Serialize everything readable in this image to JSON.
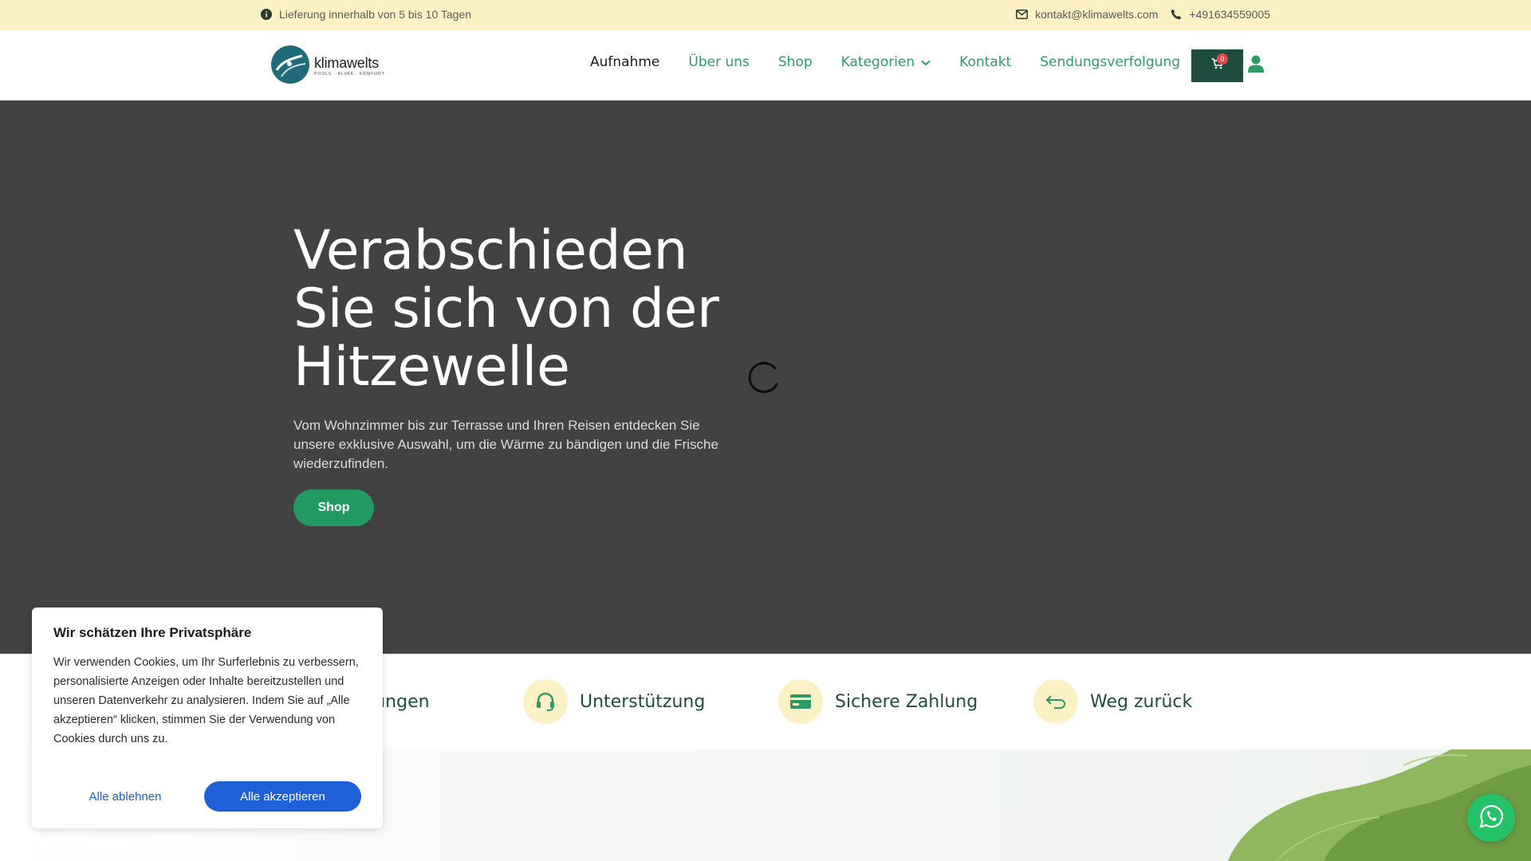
{
  "topbar": {
    "delivery": "Lieferung innerhalb von 5 bis 10 Tagen",
    "email": "kontakt@klimawelts.com",
    "phone": "+491634559005"
  },
  "logo": {
    "name": "klimawelts",
    "tagline": "POOLS · KLIMA · KOMFORT"
  },
  "nav": {
    "items": [
      {
        "label": "Aufnahme",
        "active": true
      },
      {
        "label": "Über uns"
      },
      {
        "label": "Shop"
      },
      {
        "label": "Kategorien",
        "dropdown": true
      },
      {
        "label": "Kontakt"
      },
      {
        "label": "Sendungsverfolgung"
      }
    ],
    "cart_count": "0"
  },
  "hero": {
    "title": "Verabschieden Sie sich von der Hitzewelle",
    "text": "Vom Wohnzimmer bis zur Terrasse und Ihren Reisen entdecken Sie unsere exklusive Auswahl, um die Wärme zu bändigen und die Frische wiederzufinden.",
    "button": "Shop"
  },
  "features": [
    {
      "label": "Lieferungen",
      "icon": "truck-icon"
    },
    {
      "label": "Unterstützung",
      "icon": "headset-icon"
    },
    {
      "label": "Sichere Zahlung",
      "icon": "credit-card-icon"
    },
    {
      "label": "Weg zurück",
      "icon": "return-arrow-icon"
    }
  ],
  "cookie": {
    "title": "Wir schätzen Ihre Privatsphäre",
    "text": "Wir verwenden Cookies, um Ihr Surferlebnis zu verbessern, personalisierte Anzeigen oder Inhalte bereitzustellen und unseren Datenverkehr zu analysieren. Indem Sie auf „Alle akzeptieren“ klicken, stimmen Sie der Verwendung von Cookies durch uns zu.",
    "reject": "Alle ablehnen",
    "accept": "Alle akzeptieren"
  },
  "colors": {
    "topbar_bg": "#fbf1c4",
    "brand_green": "#2e9a68",
    "dark_green": "#1e4d40",
    "hero_bg": "#424242",
    "accept_blue": "#1f5fd8",
    "whatsapp_green": "#25c26a"
  }
}
